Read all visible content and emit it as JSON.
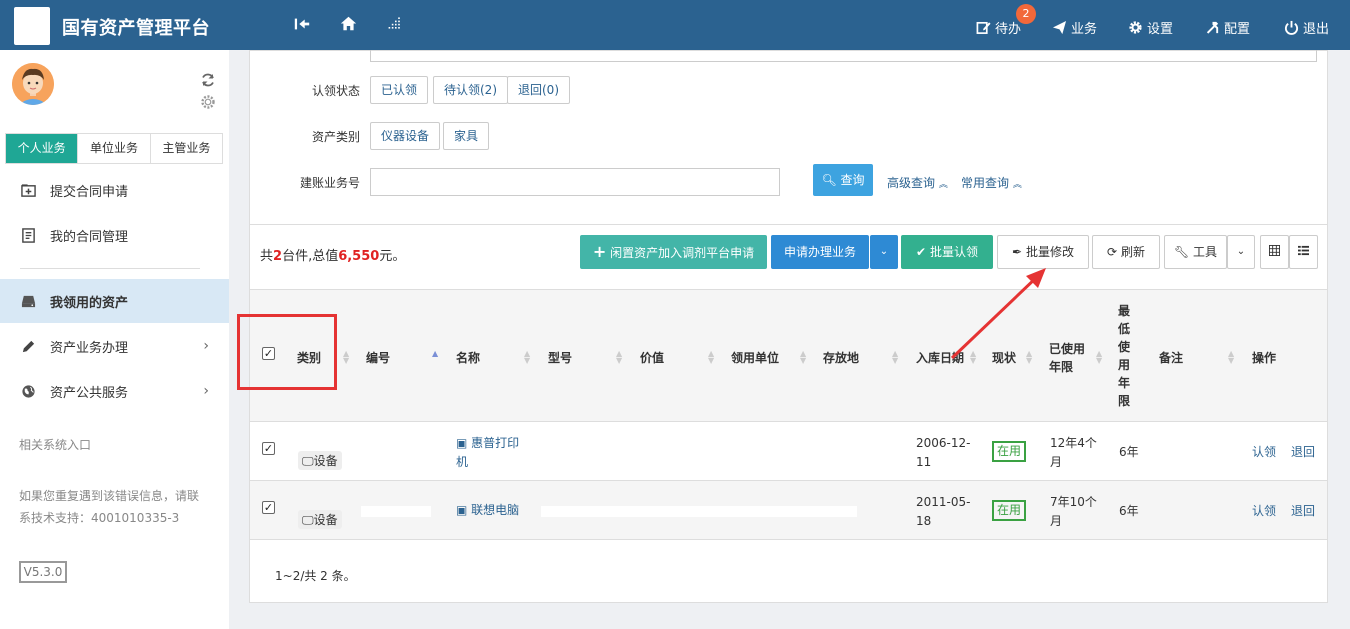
{
  "header": {
    "app_title": "国有资产管理平台",
    "todo_label": "待办",
    "todo_badge": "2",
    "business_label": "业务",
    "settings_label": "设置",
    "config_label": "配置",
    "logout_label": "退出"
  },
  "sidebar": {
    "tabs": [
      "个人业务",
      "单位业务",
      "主管业务"
    ],
    "menu": {
      "submit_contract": "提交合同申请",
      "my_contract": "我的合同管理",
      "my_assets": "我领用的资产",
      "asset_business": "资产业务办理",
      "public_service": "资产公共服务"
    },
    "related_entry": "相关系统入口",
    "help_line1": "如果您重复遇到该错误信息，请联",
    "help_line2": "系技术支持：4001010335-3",
    "version": "V5.3.0"
  },
  "form": {
    "claim_status_label": "认领状态",
    "claim_status_options": [
      "已认领",
      "待认领(2)",
      "退回(0)"
    ],
    "asset_type_label": "资产类别",
    "asset_type_options": [
      "仪器设备",
      "家具"
    ],
    "account_no_label": "建账业务号",
    "account_no_value": "",
    "query_button": "查询",
    "advanced_query": "高级查询",
    "common_query": "常用查询"
  },
  "summary": {
    "prefix": "共",
    "count": "2",
    "mid": "台件,总值",
    "total": "6,550",
    "suffix": "元。"
  },
  "toolbar": {
    "idle_assets": "闲置资产加入调剂平台申请",
    "apply_business": "申请办理业务",
    "batch_claim": "批量认领",
    "batch_edit": "批量修改",
    "refresh": "刷新",
    "tools": "工具"
  },
  "table": {
    "headers": {
      "category": "类别",
      "number": "编号",
      "name": "名称",
      "model": "型号",
      "value": "价值",
      "unit": "领用单位",
      "location": "存放地",
      "date": "入库日期",
      "status": "现状",
      "used_years": "已使用年限",
      "min_years": "最低使用年限",
      "remark": "备注",
      "ops": "操作"
    },
    "rows": [
      {
        "category": "设备",
        "name_line1": "惠普打印",
        "name_line2": "机",
        "date_line1": "2006-12-",
        "date_line2": "11",
        "status": "在用",
        "used_line1": "12年4个",
        "used_line2": "月",
        "min_years": "6年",
        "op_claim": "认领",
        "op_return": "退回"
      },
      {
        "category": "设备",
        "name_line1": "联想电脑",
        "date_line1": "2011-05-",
        "date_line2": "18",
        "status": "在用",
        "used_line1": "7年10个",
        "used_line2": "月",
        "min_years": "6年",
        "op_claim": "认领",
        "op_return": "退回"
      }
    ]
  },
  "pager": {
    "text": "1~2/共 2 条。"
  },
  "colors": {
    "header_bg": "#2b6290",
    "accent_teal": "#1fa795",
    "status_green": "#3aa142",
    "annotation_red": "#e53333"
  }
}
